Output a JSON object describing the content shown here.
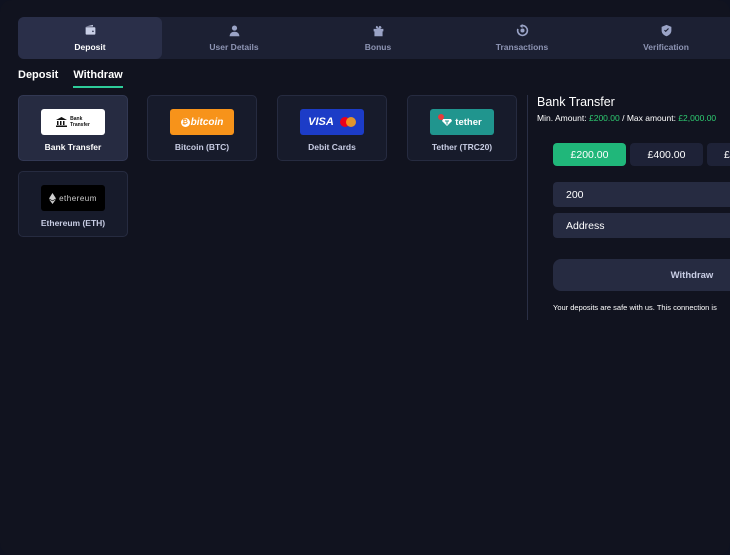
{
  "nav": {
    "tabs": [
      {
        "label": "Deposit",
        "icon": "wallet-icon"
      },
      {
        "label": "User Details",
        "icon": "user-icon"
      },
      {
        "label": "Bonus",
        "icon": "gift-icon"
      },
      {
        "label": "Transactions",
        "icon": "transactions-icon"
      },
      {
        "label": "Verification",
        "icon": "shield-check-icon"
      }
    ],
    "active": "Deposit"
  },
  "subtabs": [
    {
      "label": "Deposit"
    },
    {
      "label": "Withdraw"
    }
  ],
  "active_subtab": "Withdraw",
  "methods": [
    {
      "label": "Bank Transfer",
      "logo_text_1": "Bank",
      "logo_text_2": "Transfer"
    },
    {
      "label": "Bitcoin (BTC)",
      "logo_text": "bitcoin",
      "coin_symbol": "₿"
    },
    {
      "label": "Debit Cards",
      "logo_text": "VISA"
    },
    {
      "label": "Tether (TRC20)",
      "logo_text": "tether"
    },
    {
      "label": "Ethereum (ETH)",
      "logo_text": "ethereum"
    }
  ],
  "selected_method": "Bank Transfer",
  "panel": {
    "title": "Bank Transfer",
    "min_label": "Min. Amount:",
    "min_value": "£200.00",
    "separator": "/ Max amount:",
    "max_value": "£2,000.00",
    "amount_options": [
      "£200.00",
      "£400.00",
      "£"
    ],
    "selected_amount": "£200.00",
    "amount_value": "200",
    "address_placeholder": "Address",
    "submit_label": "Withdraw",
    "safe_text": "Your deposits are safe with us. This connection is"
  },
  "colors": {
    "accent": "#2ecc9a",
    "selected_amount": "#20b77a",
    "background": "#11131f"
  }
}
